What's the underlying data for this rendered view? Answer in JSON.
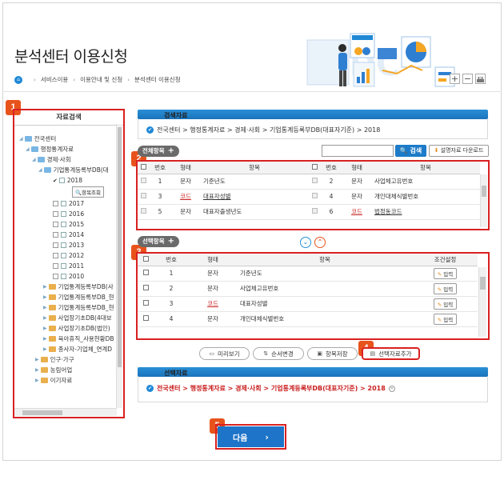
{
  "header": {
    "title": "분석센터 이용신청",
    "breadcrumb": [
      "서비스이용",
      "이용안내 및 신청",
      "분석센터 이용신청"
    ],
    "tools": {
      "zoom_in": "+",
      "zoom_out": "−"
    },
    "illustration_letters": "SDC"
  },
  "badges": [
    "1",
    "2",
    "3",
    "4",
    "5"
  ],
  "tree": {
    "title": "자료검색",
    "items": [
      {
        "label": "전국센터",
        "kind": "folder",
        "indent": 0
      },
      {
        "label": "행정통계자료",
        "kind": "folder",
        "indent": 1
      },
      {
        "label": "경제·사회",
        "kind": "folder",
        "indent": 2
      },
      {
        "label": "기업통계등록부DB(대",
        "kind": "folder",
        "indent": 3
      },
      {
        "label": "2018",
        "kind": "checked",
        "indent": 4
      },
      {
        "label": "2017",
        "kind": "year",
        "indent": 4
      },
      {
        "label": "2016",
        "kind": "year",
        "indent": 4
      },
      {
        "label": "2015",
        "kind": "year",
        "indent": 4
      },
      {
        "label": "2014",
        "kind": "year",
        "indent": 4
      },
      {
        "label": "2013",
        "kind": "year",
        "indent": 4
      },
      {
        "label": "2012",
        "kind": "year",
        "indent": 4
      },
      {
        "label": "2011",
        "kind": "year",
        "indent": 4
      },
      {
        "label": "2010",
        "kind": "year",
        "indent": 4
      },
      {
        "label": "기업통계등록부DB(사",
        "kind": "subfolder",
        "indent": 3
      },
      {
        "label": "기업통계등록부DB_현",
        "kind": "subfolder",
        "indent": 3
      },
      {
        "label": "기업통계등록부DB_현",
        "kind": "subfolder",
        "indent": 3
      },
      {
        "label": "사업장기초DB(4대보",
        "kind": "subfolder",
        "indent": 3
      },
      {
        "label": "사업장기초DB(법인)",
        "kind": "subfolder",
        "indent": 3
      },
      {
        "label": "육아휴직_사용현황DB",
        "kind": "subfolder",
        "indent": 3
      },
      {
        "label": "종사자-기업체_연계D",
        "kind": "subfolder",
        "indent": 3
      },
      {
        "label": "인구·가구",
        "kind": "subfolder",
        "indent": 2
      },
      {
        "label": "농림어업",
        "kind": "subfolder",
        "indent": 2
      },
      {
        "label": "이기자료",
        "kind": "subfolder",
        "indent": 2
      }
    ],
    "item_button": "항목조회"
  },
  "search_section": {
    "title": "검색자료",
    "path": "전국센터 > 행정통계자료 > 경제·사회 > 기업통계등록부DB(대표자기준) > 2018"
  },
  "all_items": {
    "label": "전체항목",
    "search_button": "검색",
    "download_button": "설명자료 다운로드",
    "headers": [
      "번호",
      "형태",
      "항목",
      "번호",
      "형태",
      "항목"
    ],
    "rows": [
      {
        "no1": "1",
        "type1": "문자",
        "name1": "기준년도",
        "no2": "2",
        "type2": "문자",
        "name2": "사업체고유번호"
      },
      {
        "no1": "3",
        "type1": "코드",
        "name1": "대표자성별",
        "no2": "4",
        "type2": "문자",
        "name2": "개인대체식별번호"
      },
      {
        "no1": "5",
        "type1": "문자",
        "name1": "대표자출생년도",
        "no2": "6",
        "type2": "코드",
        "name2": "법정동코드"
      }
    ]
  },
  "selected_items": {
    "label": "선택항목",
    "headers": [
      "번호",
      "형태",
      "항목",
      "조건설정"
    ],
    "edit_label": "입력",
    "rows": [
      {
        "no": "1",
        "type": "문자",
        "name": "기준년도"
      },
      {
        "no": "2",
        "type": "문자",
        "name": "사업체고유번호"
      },
      {
        "no": "3",
        "type": "코드",
        "name": "대표자성별"
      },
      {
        "no": "4",
        "type": "문자",
        "name": "개인대체식별번호"
      }
    ]
  },
  "actions": {
    "preview": "미리보기",
    "reorder": "순서변경",
    "save_items": "항목저장",
    "add_selected": "선택자료추가"
  },
  "selected_data": {
    "title": "선택자료",
    "path": "전국센터 > 행정통계자료 > 경제·사회 > 기업통계등록부DB(대표자기준) > 2018"
  },
  "next_button": "다음",
  "colors": {
    "accent": "#1d74c8",
    "highlight": "#d92121",
    "badge": "#e8531c"
  }
}
